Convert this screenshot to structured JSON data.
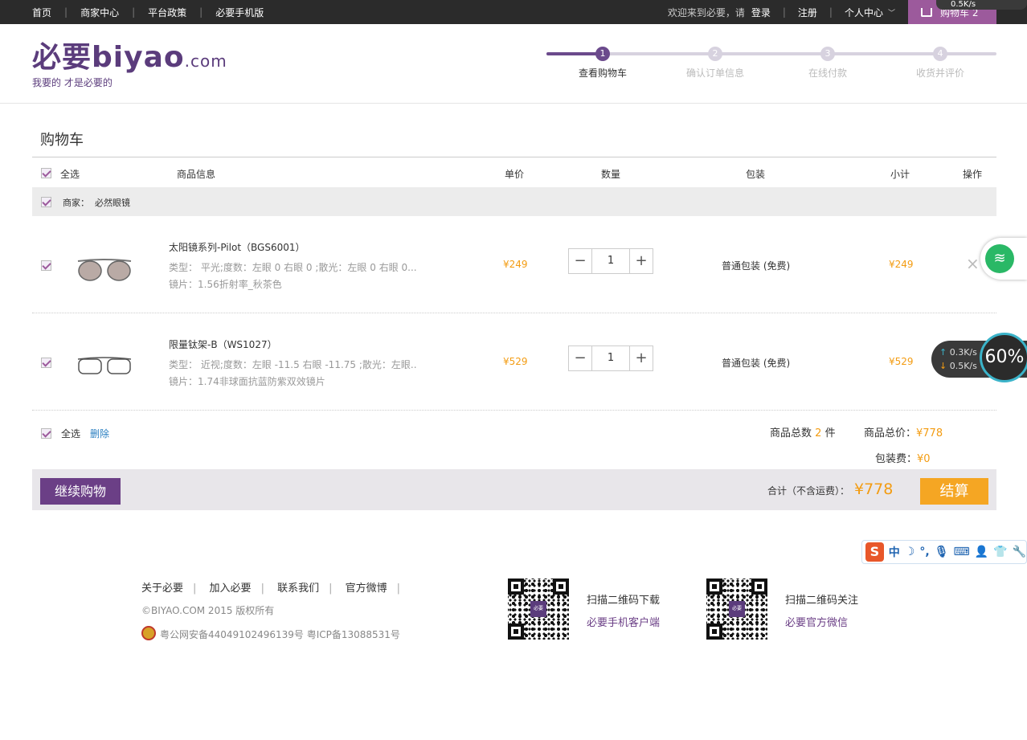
{
  "topnav": {
    "links": [
      "首页",
      "商家中心",
      "平台政策",
      "必要手机版"
    ],
    "welcome": "欢迎来到必要，请",
    "login": "登录",
    "register": "注册",
    "personal": "个人中心",
    "cart": "购物车 2",
    "speed_top": "0.5K/s"
  },
  "logo": {
    "main": "必要biyao",
    "com": ".com",
    "slogan": "我要的 才是必要的"
  },
  "steps": [
    {
      "num": "1",
      "label": "查看购物车"
    },
    {
      "num": "2",
      "label": "确认订单信息"
    },
    {
      "num": "3",
      "label": "在线付款"
    },
    {
      "num": "4",
      "label": "收货并评价"
    }
  ],
  "cart": {
    "title": "购物车",
    "headers": {
      "select_all": "全选",
      "info": "商品信息",
      "price": "单价",
      "qty": "数量",
      "pack": "包装",
      "subtotal": "小计",
      "op": "操作"
    },
    "shop_label": "商家：",
    "shop_name": "必然眼镜",
    "items": [
      {
        "name": "太阳镜系列-Pilot（BGS6001）",
        "type": "类型： 平光;度数：左眼 0 右眼 0 ;散光：左眼 0 右眼 0...",
        "lens": "镜片：1.56折射率_秋茶色",
        "price": "¥249",
        "qty": "1",
        "pack": "普通包装 (免费)",
        "subtotal": "¥249"
      },
      {
        "name": "限量钛架-B（WS1027）",
        "type": "类型： 近视;度数：左眼 -11.5 右眼 -11.75 ;散光：左眼..",
        "lens": "镜片：1.74非球面抗蓝防紫双效镜片",
        "price": "¥529",
        "qty": "1",
        "pack": "普通包装 (免费)",
        "subtotal": "¥529"
      }
    ],
    "minus": "−",
    "plus": "+",
    "delete_x": "×",
    "footer_select": "全选",
    "delete": "删除",
    "count_label": "商品总数",
    "count": "2",
    "count_unit": "件",
    "total_label": "商品总价：",
    "total": "¥778",
    "pack_fee_label": "包装费：",
    "pack_fee": "¥0",
    "continue": "继续购物",
    "sum_label": "合计（不含运费）：",
    "sum": "¥778",
    "checkout": "结算"
  },
  "footer": {
    "links": [
      "关于必要",
      "加入必要",
      "联系我们",
      "官方微博"
    ],
    "copyright": "©BIYAO.COM 2015 版权所有",
    "icp": "粤公网安备44049102496139号  粤ICP备13088531号",
    "qr1_title": "扫描二维码下载",
    "qr1_sub": "必要手机客户端",
    "qr2_title": "扫描二维码关注",
    "qr2_sub": "必要官方微信",
    "qr_center": "必要"
  },
  "overlay": {
    "up": "0.3K/s",
    "down": "0.5K/s",
    "percent": "60%",
    "ime_zh": "中",
    "ime_s": "S"
  }
}
